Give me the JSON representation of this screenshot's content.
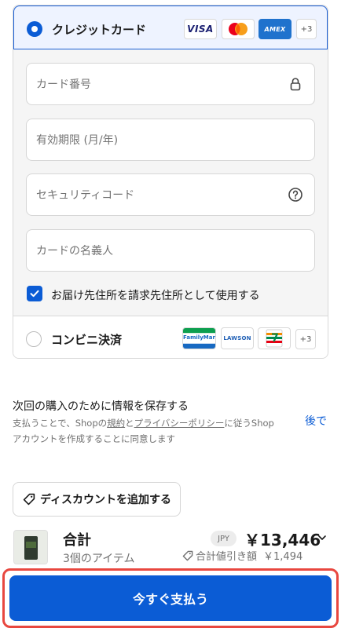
{
  "payment": {
    "card": {
      "label": "クレジットカード",
      "selected": true,
      "logos": [
        "visa-logo",
        "mastercard-logo",
        "amex-logo"
      ],
      "visa_text": "VISA",
      "amex_text": "AMEX",
      "more_badge": "+3",
      "fields": {
        "card_number_placeholder": "カード番号",
        "expiry_placeholder": "有効期限 (月/年)",
        "security_code_placeholder": "セキュリティコード",
        "cardholder_placeholder": "カードの名義人"
      },
      "billing_same_as_shipping": {
        "label": "お届け先住所を請求先住所として使用する",
        "checked": true
      }
    },
    "konbini": {
      "label": "コンビニ決済",
      "selected": false,
      "logos": [
        "familymart-logo",
        "lawson-logo",
        "seven-eleven-logo"
      ],
      "familymart_text": "FamilyMart",
      "lawson_text": "LAWSON",
      "seven_text": "7",
      "more_badge": "+3"
    }
  },
  "save_info": {
    "title": "次回の購入のために情報を保存する",
    "desc_part1": "支払うことで、Shopの",
    "terms_link": "規約",
    "desc_part2": "と",
    "privacy_link": "プライバシーポリシー",
    "desc_part3": "に従うShopアカウントを作成することに同意します",
    "later_link": "後で"
  },
  "discount": {
    "button_label": "ディスカウントを追加する"
  },
  "summary": {
    "total_label": "合計",
    "items_label": "3個のアイテム",
    "currency": "JPY",
    "total_amount": "￥13,446",
    "discount_label": "合計値引き額",
    "discount_amount": "￥1,494"
  },
  "pay_button": {
    "label": "今すぐ支払う"
  },
  "colors": {
    "primary": "#0b5cd5",
    "highlight_outline": "#e8473f"
  }
}
